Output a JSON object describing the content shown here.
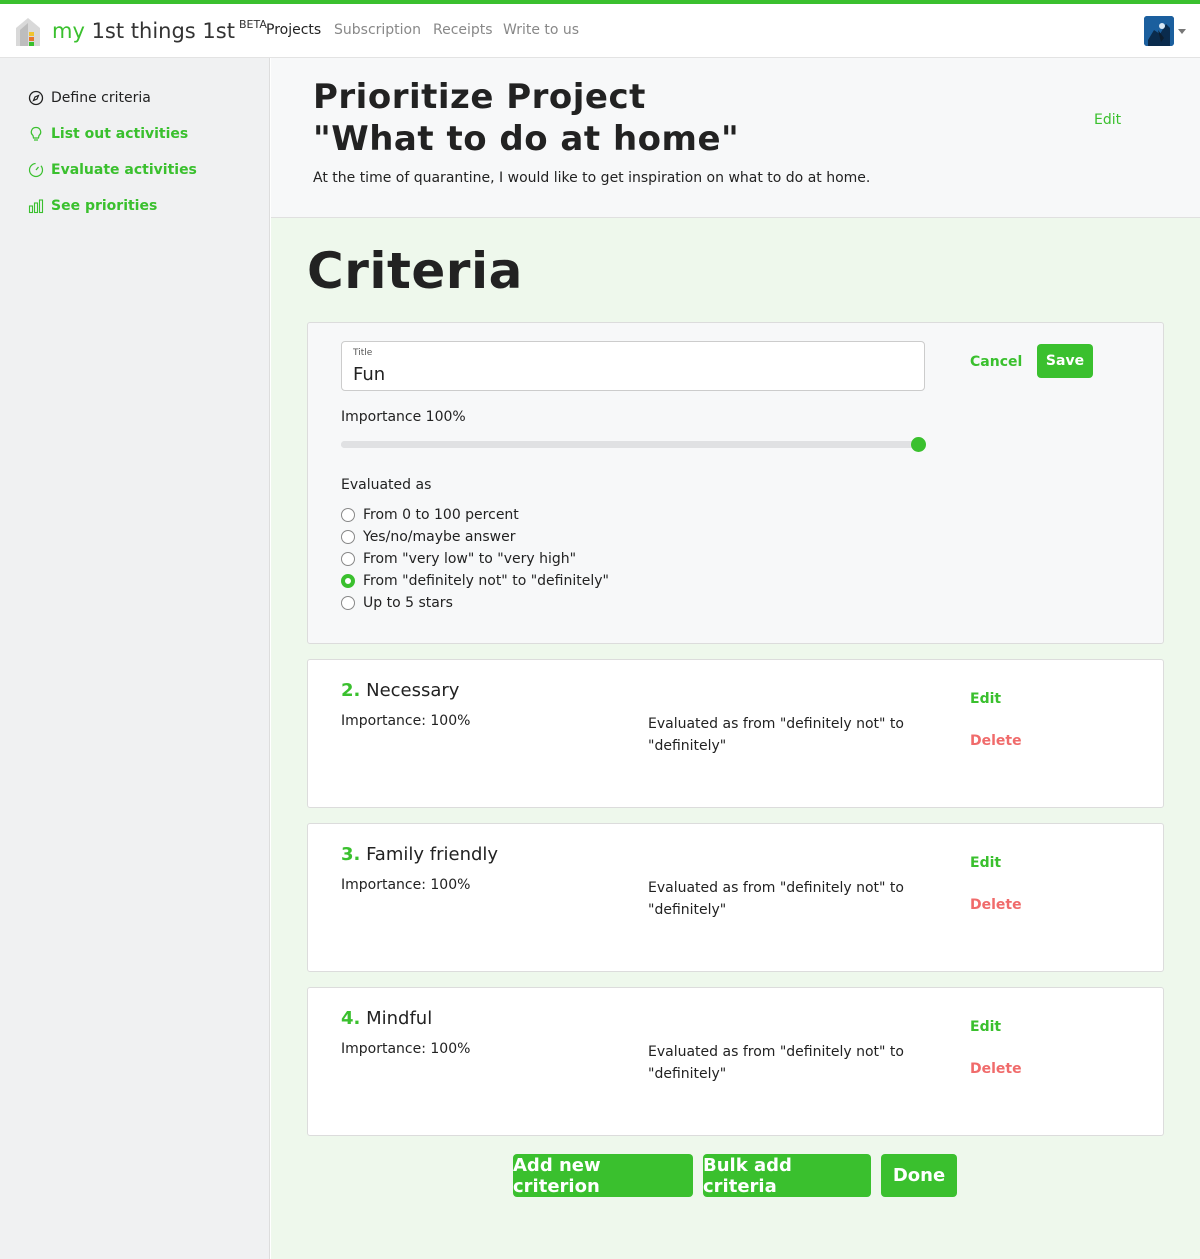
{
  "brand": {
    "prefix": "my",
    "rest": " 1st things 1st",
    "badge": "BETA"
  },
  "nav": [
    {
      "label": "Projects",
      "active": true
    },
    {
      "label": "Subscription",
      "active": false
    },
    {
      "label": "Receipts",
      "active": false
    },
    {
      "label": "Write to us",
      "active": false
    }
  ],
  "sidebar": {
    "items": [
      {
        "label": "Define criteria",
        "icon": "compass-icon",
        "active": true
      },
      {
        "label": "List out activities",
        "icon": "lightbulb-icon",
        "active": false
      },
      {
        "label": "Evaluate activities",
        "icon": "gauge-icon",
        "active": false
      },
      {
        "label": "See priorities",
        "icon": "bar-chart-icon",
        "active": false
      }
    ]
  },
  "project": {
    "title_line1": "Prioritize Project",
    "title_line2": "\"What to do at home\"",
    "edit_label": "Edit",
    "description": "At the time of quarantine, I would like to get inspiration on what to do at home."
  },
  "section_title": "Criteria",
  "editing_criterion": {
    "field_label": "Title",
    "field_value": "Fun",
    "cancel_label": "Cancel",
    "save_label": "Save",
    "importance_label": "Importance 100%",
    "importance_value": 1.0,
    "evaluated_label": "Evaluated as",
    "options": [
      {
        "label": "From 0 to 100 percent",
        "checked": false
      },
      {
        "label": "Yes/no/maybe answer",
        "checked": false
      },
      {
        "label": "From \"very low\" to \"very high\"",
        "checked": false
      },
      {
        "label": "From \"definitely not\" to \"definitely\"",
        "checked": true
      },
      {
        "label": "Up to 5 stars",
        "checked": false
      }
    ]
  },
  "criteria": [
    {
      "num": "2.",
      "title": "Necessary",
      "importance": "Importance: 100%",
      "evaluated": "Evaluated as from \"definitely not\" to \"definitely\"",
      "edit": "Edit",
      "delete": "Delete"
    },
    {
      "num": "3.",
      "title": "Family friendly",
      "importance": "Importance: 100%",
      "evaluated": "Evaluated as from \"definitely not\" to \"definitely\"",
      "edit": "Edit",
      "delete": "Delete"
    },
    {
      "num": "4.",
      "title": "Mindful",
      "importance": "Importance: 100%",
      "evaluated": "Evaluated as from \"definitely not\" to \"definitely\"",
      "edit": "Edit",
      "delete": "Delete"
    }
  ],
  "actions": {
    "add_label": "Add new criterion",
    "bulk_label": "Bulk add criteria",
    "done_label": "Done"
  },
  "colors": {
    "accent": "#3ac02e",
    "danger": "#f06b6b",
    "sidebar_bg": "#f0f1f2",
    "main_bg": "#eef8ec"
  }
}
